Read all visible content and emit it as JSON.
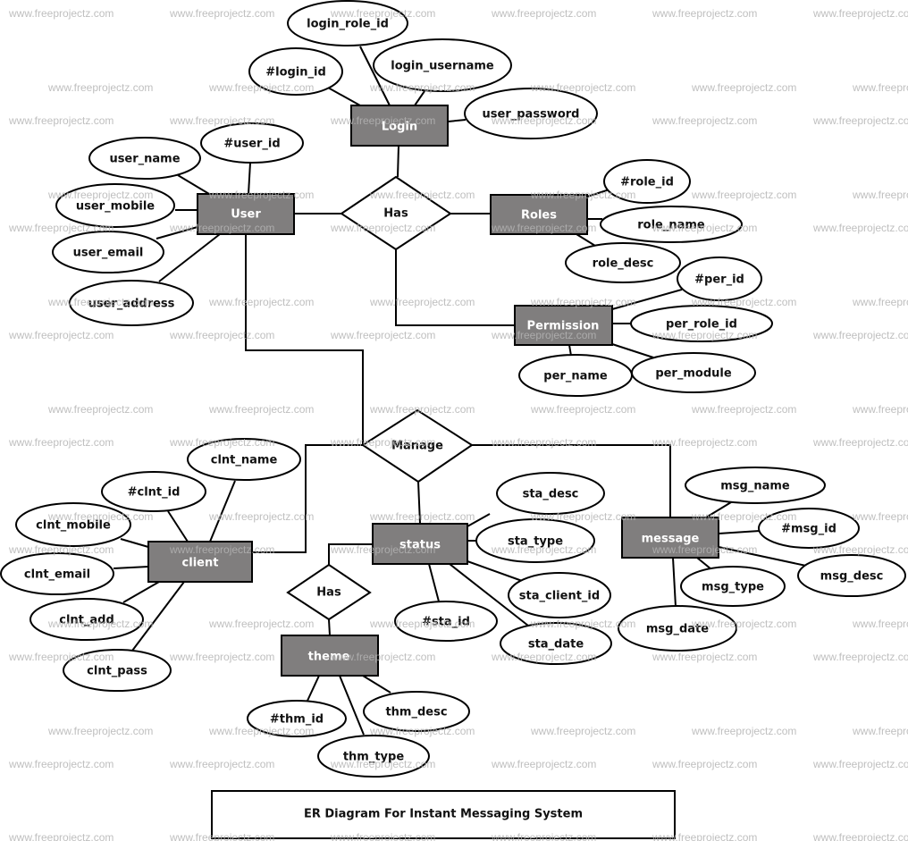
{
  "title": "ER Diagram For Instant Messaging System",
  "watermark": "www.freeprojectz.com",
  "colors": {
    "entity_fill": "#807e7e",
    "entity_text": "#ffffff",
    "stroke": "#000000",
    "watermark": "#b4b4b4"
  },
  "entities": {
    "login": "Login",
    "user": "User",
    "roles": "Roles",
    "permission": "Permission",
    "client": "client",
    "status": "status",
    "message": "message",
    "theme": "theme"
  },
  "relationships": {
    "has_main": "Has",
    "manage": "Manage",
    "has_theme": "Has"
  },
  "attributes": {
    "login": [
      "login_role_id",
      "#login_id",
      "login_username",
      "user_password"
    ],
    "user": [
      "#user_id",
      "user_name",
      "user_mobile",
      "user_email",
      "user_address"
    ],
    "roles": [
      "#role_id",
      "role_name",
      "role_desc"
    ],
    "permission": [
      "#per_id",
      "per_role_id",
      "per_name",
      "per_module"
    ],
    "client": [
      "clnt_name",
      "#clnt_id",
      "clnt_mobile",
      "clnt_email",
      "clnt_add",
      "clnt_pass"
    ],
    "status": [
      "sta_desc",
      "sta_type",
      "sta_client_id",
      "#sta_id",
      "sta_date"
    ],
    "message": [
      "msg_name",
      "#msg_id",
      "msg_desc",
      "msg_type",
      "msg_date"
    ],
    "theme": [
      "#thm_id",
      "thm_desc",
      "thm_type"
    ]
  }
}
